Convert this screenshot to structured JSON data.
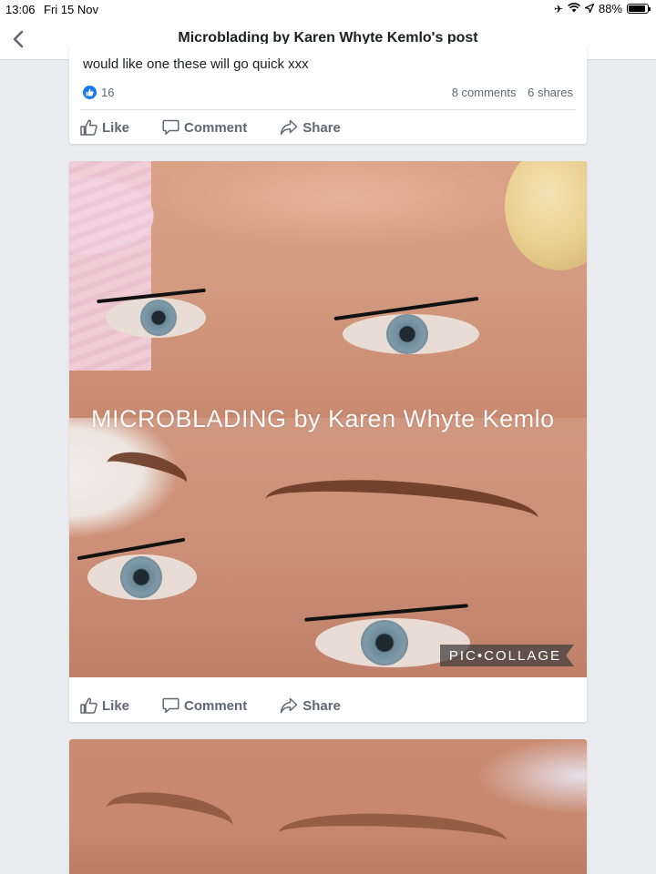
{
  "status_bar": {
    "time": "13:06",
    "date": "Fri 15 Nov",
    "battery": "88%",
    "battery_level": 0.88,
    "icons": [
      "airplane-icon",
      "wifi-icon",
      "location-icon",
      "battery-icon"
    ]
  },
  "nav": {
    "back_icon": "chevron-left-icon",
    "title": "Microblading by Karen Whyte Kemlo's post"
  },
  "posts": [
    {
      "text": "would like one these will go quick xxx",
      "reactions": "16",
      "comments": "8 comments",
      "shares": "6 shares",
      "actions": {
        "like": "Like",
        "comment": "Comment",
        "share": "Share"
      }
    },
    {
      "image_watermark": "MICROBLADING by Karen Whyte Kemlo",
      "image_badge": "PIC•COLLAGE",
      "actions": {
        "like": "Like",
        "comment": "Comment",
        "share": "Share"
      }
    }
  ],
  "colors": {
    "accent": "#1877f2",
    "background": "#e9ebee",
    "action_text": "#606770"
  }
}
